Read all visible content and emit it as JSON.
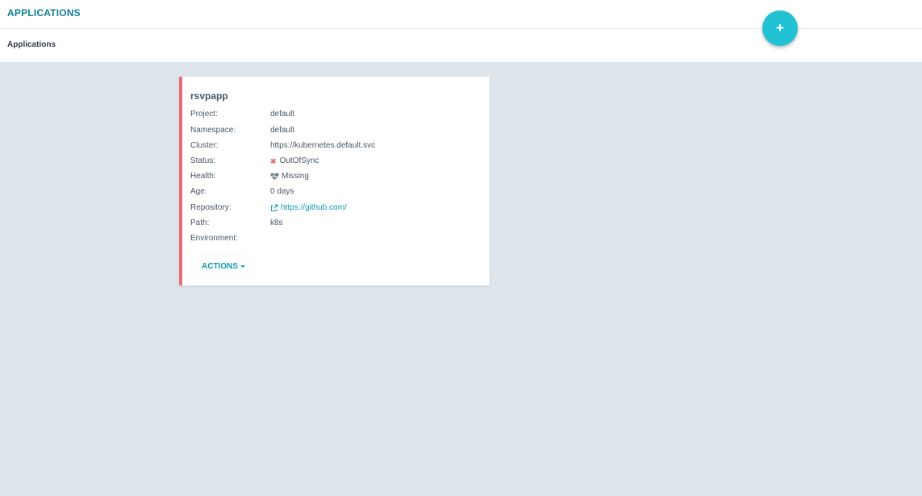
{
  "header": {
    "title": "APPLICATIONS",
    "breadcrumb": "Applications",
    "add_button_label": "+"
  },
  "app_card": {
    "name": "rsvpapp",
    "fields": {
      "project": {
        "label": "Project:",
        "value": "default"
      },
      "namespace": {
        "label": "Namespace:",
        "value": "default"
      },
      "cluster": {
        "label": "Cluster:",
        "value": "https://kubernetes.default.svc"
      },
      "status": {
        "label": "Status:",
        "value": "OutOfSync",
        "icon": "x-icon"
      },
      "health": {
        "label": "Health:",
        "value": "Missing",
        "icon": "heart-pulse-icon"
      },
      "age": {
        "label": "Age:",
        "value": "0 days"
      },
      "repository": {
        "label": "Repository:",
        "value": "https://github.com/",
        "icon": "external-link-icon"
      },
      "path": {
        "label": "Path:",
        "value": "k8s"
      },
      "environment": {
        "label": "Environment:",
        "value": ""
      }
    },
    "actions_label": "ACTIONS",
    "border_color": "#e96d76"
  },
  "colors": {
    "accent": "#0d7e96",
    "fab": "#22c1d4",
    "background": "#dee6ec",
    "status_outofsync": "#e96d76"
  }
}
